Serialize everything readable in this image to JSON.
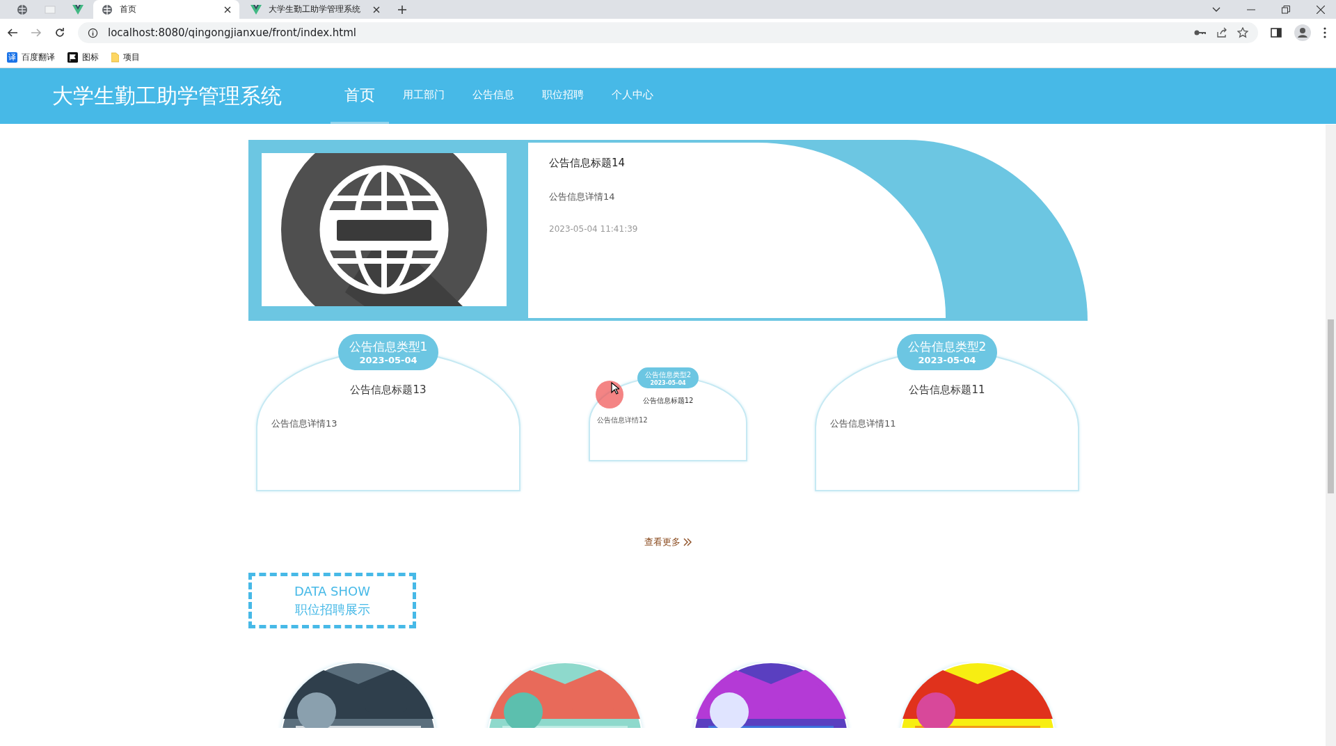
{
  "browser": {
    "tabs": [
      {
        "label": "首页",
        "selected": true,
        "kind": "globe"
      },
      {
        "label": "大学生勤工助学管理系统",
        "selected": false,
        "kind": "vue"
      }
    ],
    "url": "localhost:8080/qingongjianxue/front/index.html",
    "bookmarks": [
      {
        "label": "百度翻译",
        "kind": "translate",
        "icon_text": "译"
      },
      {
        "label": "图标",
        "kind": "flag"
      },
      {
        "label": "项目",
        "kind": "folder"
      }
    ]
  },
  "site": {
    "title": "大学生勤工助学管理系统",
    "nav": [
      {
        "label": "首页",
        "selected": true
      },
      {
        "label": "用工部门",
        "selected": false
      },
      {
        "label": "公告信息",
        "selected": false
      },
      {
        "label": "职位招聘",
        "selected": false
      },
      {
        "label": "个人中心",
        "selected": false
      }
    ]
  },
  "featured": {
    "title": "公告信息标题14",
    "detail": "公告信息详情14",
    "time": "2023-05-04 11:41:39"
  },
  "notices": [
    {
      "kind": "large",
      "type": "公告信息类型1",
      "date": "2023-05-04",
      "title": "公告信息标题13",
      "detail": "公告信息详情13"
    },
    {
      "kind": "small",
      "type": "公告信息类型2",
      "date": "2023-05-04",
      "title": "公告信息标题12",
      "detail": "公告信息详情12"
    },
    {
      "kind": "large",
      "type": "公告信息类型2",
      "date": "2023-05-04",
      "title": "公告信息标题11",
      "detail": "公告信息详情11"
    }
  ],
  "more": "查看更多",
  "data_show": {
    "heading": "DATA SHOW",
    "subheading": "职位招聘展示"
  }
}
